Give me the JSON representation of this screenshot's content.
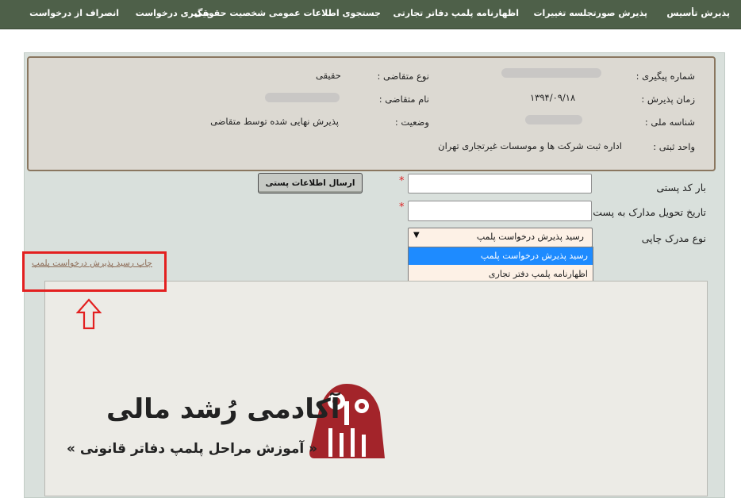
{
  "nav": {
    "items": [
      {
        "label": "پذیرش تأسیس"
      },
      {
        "label": "پذیرش صورتجلسه تغییرات"
      },
      {
        "label": "اظهارنامه پلمپ دفاتر تجارتی"
      },
      {
        "label": "جستجوی اطلاعات عمومی شخصیت حقوقی"
      },
      {
        "label": "پیگیری درخواست"
      },
      {
        "label": "انصراف از درخواست"
      }
    ]
  },
  "info": {
    "tracking_label": "شماره پیگیری :",
    "accept_time_label": "زمان پذیرش :",
    "accept_time_value": "۱۳۹۴/۰۹/۱۸",
    "national_id_label": "شناسه ملی :",
    "reg_unit_label": "واحد ثبتی :",
    "reg_unit_value": "اداره ثبت شرکت ها و موسسات غیرتجاری تهران",
    "applicant_type_label": "نوع متقاضی :",
    "applicant_type_value": "حقیقی",
    "applicant_name_label": "نام متقاضی :",
    "status_label": "وضعیت :",
    "status_value": "پذیرش نهایی شده توسط متقاضی"
  },
  "form": {
    "postal_barcode_label": "بار کد پستی",
    "delivery_date_label": "تاریخ تحویل مدارک به پست",
    "doc_type_label": "نوع مدرک چاپی",
    "required_mark": "*",
    "submit_label": "ارسال اطلاعات پستی",
    "postal_barcode_value": "",
    "delivery_date_value": "",
    "doc_type_selected": "رسید پذیرش درخواست پلمپ",
    "dropdown_arrow": "▼",
    "options": [
      {
        "label": "رسید پذیرش درخواست پلمپ"
      },
      {
        "label": "اظهارنامه پلمپ دفتر تجاری"
      }
    ],
    "print_link": "چاپ رسید پذیرش درخواست پلمپ"
  },
  "brand": {
    "title": "آکادمی رُشد مالی",
    "subtitle": "« آموزش مراحل پلمپ دفاتر قانونی »",
    "accent": "#a3242a"
  },
  "colors": {
    "nav_bg": "#4e6049",
    "highlight": "#e32020",
    "option_active": "#1e8bff"
  }
}
